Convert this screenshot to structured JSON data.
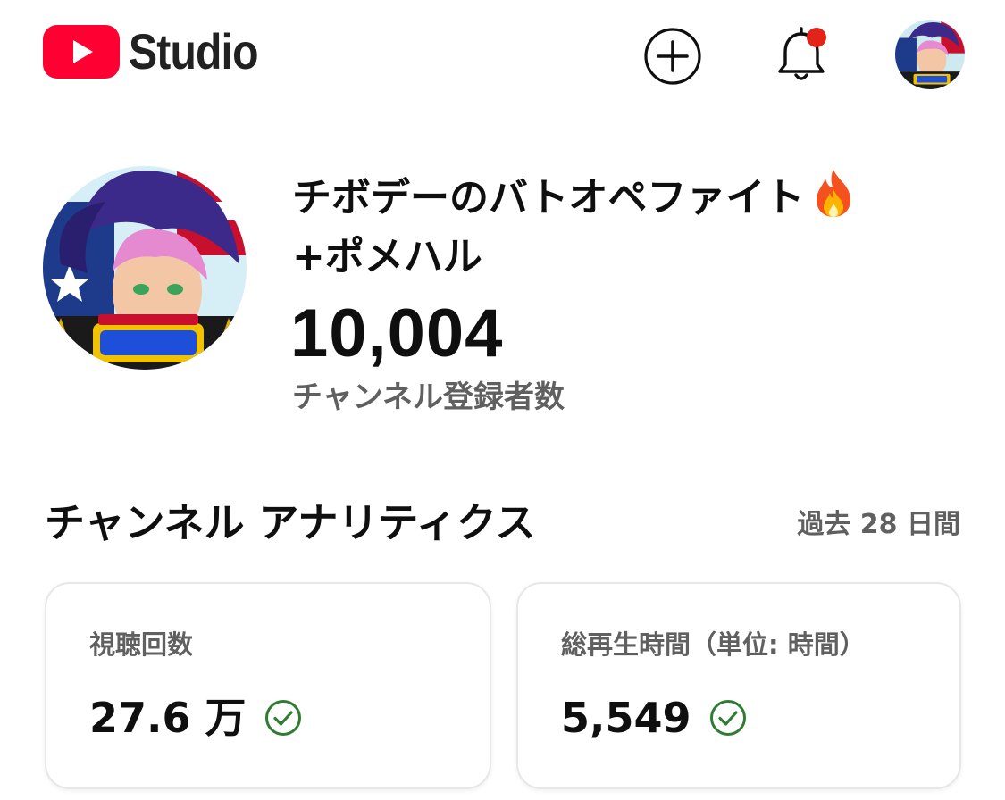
{
  "header": {
    "logo_text": "Studio",
    "icons": {
      "logo": "youtube-play-logo",
      "create": "create-plus-icon",
      "notifications": "bell-icon",
      "account": "account-avatar"
    },
    "notification_dot_color": "#e2231a"
  },
  "channel": {
    "name_line1": "チボデーのバトオペファイト",
    "name_line2": "+ポメハル",
    "name_emoji": "fire-emoji",
    "subscriber_count": "10,004",
    "subscriber_label": "チャンネル登録者数"
  },
  "analytics": {
    "title": "チャンネル アナリティクス",
    "period": "過去 28 日間",
    "cards": [
      {
        "label": "視聴回数",
        "value": "27.6 万",
        "status_icon": "check-circle-icon"
      },
      {
        "label": "総再生時間（単位: 時間）",
        "value": "5,549",
        "status_icon": "check-circle-icon"
      }
    ]
  },
  "colors": {
    "brand_red": "#ff0033",
    "text_primary": "#0f0f0f",
    "text_secondary": "#606060",
    "check_green": "#2e7d32",
    "card_border": "#e7e7e7"
  }
}
